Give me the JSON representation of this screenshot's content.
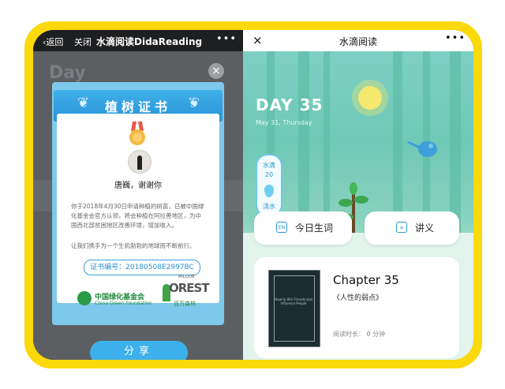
{
  "left": {
    "nav": {
      "back": "返回",
      "close": "关闭",
      "title": "水滴阅读DidaReading",
      "more": "•••"
    },
    "bg_day": "Day",
    "dialog_close": "×",
    "certificate": {
      "title": "植树证书",
      "user_line": "唐巍，谢谢你",
      "body": "你于2018年4月30日申请种植的树苗，已被中国绿化基金会官方认领，将会种植在阿拉善地区，为中国西北部贫困地区改善环境，增加收入。",
      "body2": "让我们携手为一个生机勃勃的地球而不断前行。",
      "cert_no": "证书编号：20180508E2997BC",
      "logo1_cn": "中国绿化基金会",
      "logo1_en": "China Green Foundation",
      "logo2_top": "MILLION",
      "logo2_main": "OREST",
      "logo2_cn": "百万森林"
    },
    "share_button": "分享"
  },
  "right": {
    "nav": {
      "close": "×",
      "title": "水滴阅读",
      "more": "•••"
    },
    "day": "DAY 35",
    "date": "May 31, Thursday",
    "water": {
      "label": "水滴",
      "count": "20",
      "button": "浇水"
    },
    "buttons": [
      {
        "icon": "EN",
        "label": "今日生词"
      },
      {
        "icon": "",
        "label": "讲义"
      }
    ],
    "chapter": {
      "title": "Chapter 35",
      "subtitle": "《人性的弱点》",
      "reading_time": "阅读时长： 0 分钟",
      "book_cover_text": "How to Win Friends and Influence People"
    }
  },
  "colors": {
    "frame": "#fbd90a",
    "accent_blue": "#3db0ec",
    "forest": "#6fc8b6"
  }
}
